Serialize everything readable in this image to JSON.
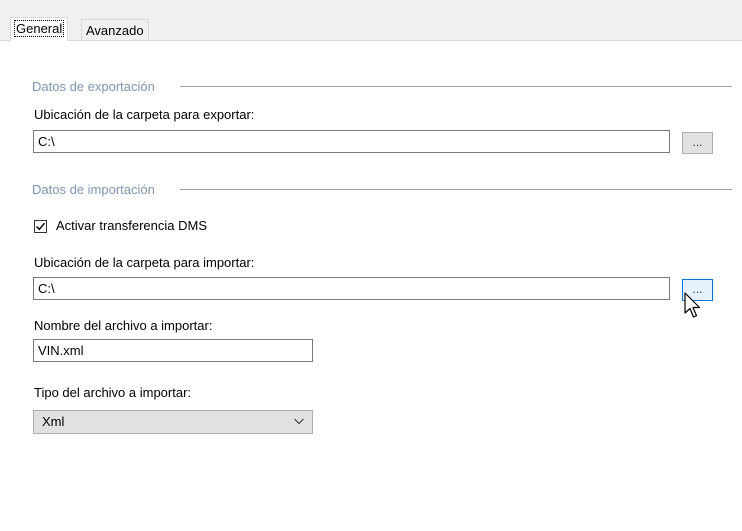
{
  "tabs": [
    {
      "label": "General",
      "active": true
    },
    {
      "label": "Avanzado",
      "active": false
    }
  ],
  "export_section": {
    "header": "Datos de exportación",
    "folder_label": "Ubicación de la carpeta para exportar:",
    "folder_value": "C:\\",
    "browse_label": "..."
  },
  "import_section": {
    "header": "Datos de importación",
    "activate_dms_label": "Activar transferencia DMS",
    "activate_dms_checked": true,
    "folder_label": "Ubicación de la carpeta para importar:",
    "folder_value": "C:\\",
    "browse_label": "...",
    "file_name_label": "Nombre del archivo a importar:",
    "file_name_value": "VIN.xml",
    "file_type_label": "Tipo del archivo a importar:",
    "file_type_value": "Xml"
  },
  "icons": {
    "checkmark": "checkmark-icon",
    "dropdown": "chevron-down-icon",
    "cursor": "mouse-pointer-icon"
  },
  "colors": {
    "group_header": "#7d96b0",
    "hover_accent": "#0078d7"
  }
}
